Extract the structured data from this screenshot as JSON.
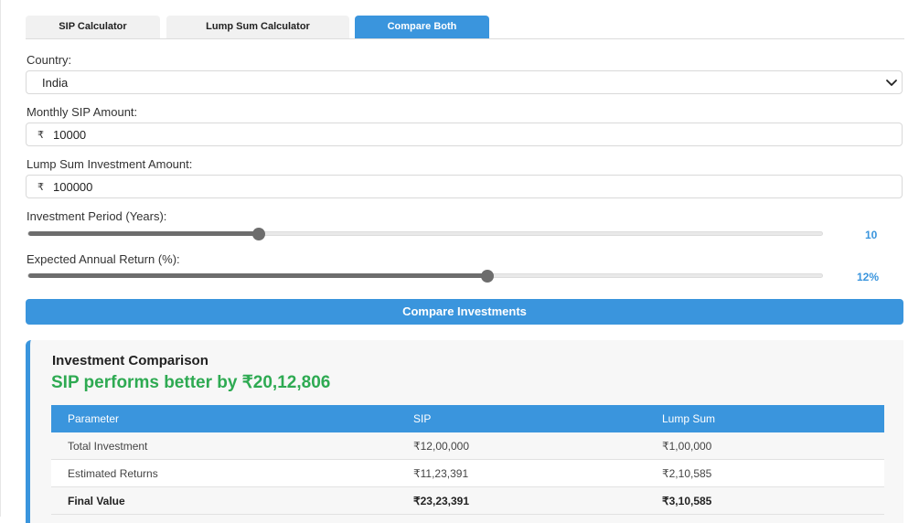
{
  "tabs": [
    {
      "label": "SIP Calculator",
      "active": false
    },
    {
      "label": "Lump Sum Calculator",
      "active": false
    },
    {
      "label": "Compare Both",
      "active": true
    }
  ],
  "country": {
    "label": "Country:",
    "value": "India"
  },
  "sip": {
    "label": "Monthly SIP Amount:",
    "currency": "₹",
    "value": "10000"
  },
  "lumpsum": {
    "label": "Lump Sum Investment Amount:",
    "currency": "₹",
    "value": "100000"
  },
  "period": {
    "label": "Investment Period (Years):",
    "display": "10",
    "fraction": 0.29
  },
  "return_rate": {
    "label": "Expected Annual Return (%):",
    "display": "12%",
    "fraction": 0.578
  },
  "compare_button": "Compare Investments",
  "results": {
    "title": "Investment Comparison",
    "verdict": "SIP performs better by ₹20,12,806",
    "headers": [
      "Parameter",
      "SIP",
      "Lump Sum"
    ],
    "rows": [
      [
        "Total Investment",
        "₹12,00,000",
        "₹1,00,000"
      ],
      [
        "Estimated Returns",
        "₹11,23,391",
        "₹2,10,585"
      ],
      [
        "Final Value",
        "₹23,23,391",
        "₹3,10,585"
      ]
    ]
  },
  "colors": {
    "accent": "#3a95dd",
    "success": "#2eaa52"
  },
  "icons": {
    "select": "chevron-down-icon"
  }
}
